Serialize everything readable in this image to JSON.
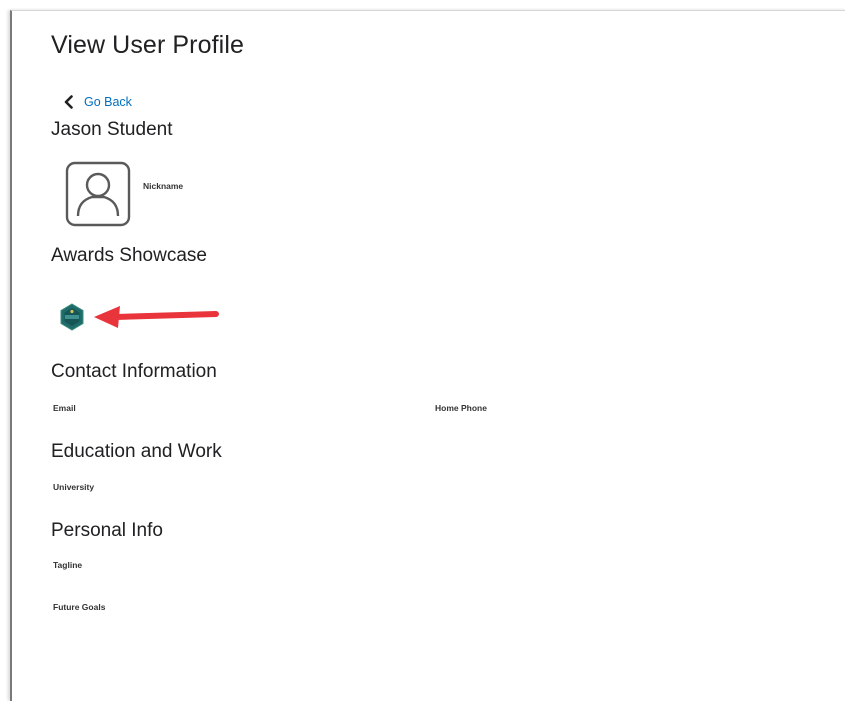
{
  "page": {
    "title": "View User Profile",
    "go_back_label": "Go Back"
  },
  "profile": {
    "name": "Jason Student",
    "nickname_label": "Nickname",
    "avatar_icon": "user-silhouette-icon"
  },
  "awards": {
    "heading": "Awards Showcase",
    "badge_icon": "award-badge-icon"
  },
  "contact": {
    "heading": "Contact Information",
    "email_label": "Email",
    "home_phone_label": "Home Phone"
  },
  "education": {
    "heading": "Education and Work",
    "university_label": "University"
  },
  "personal": {
    "heading": "Personal Info",
    "tagline_label": "Tagline",
    "future_goals_label": "Future Goals"
  },
  "colors": {
    "link": "#006fbf",
    "text": "#202122",
    "annotation_arrow": "#e8343a",
    "badge_fill": "#1f6b6b"
  }
}
